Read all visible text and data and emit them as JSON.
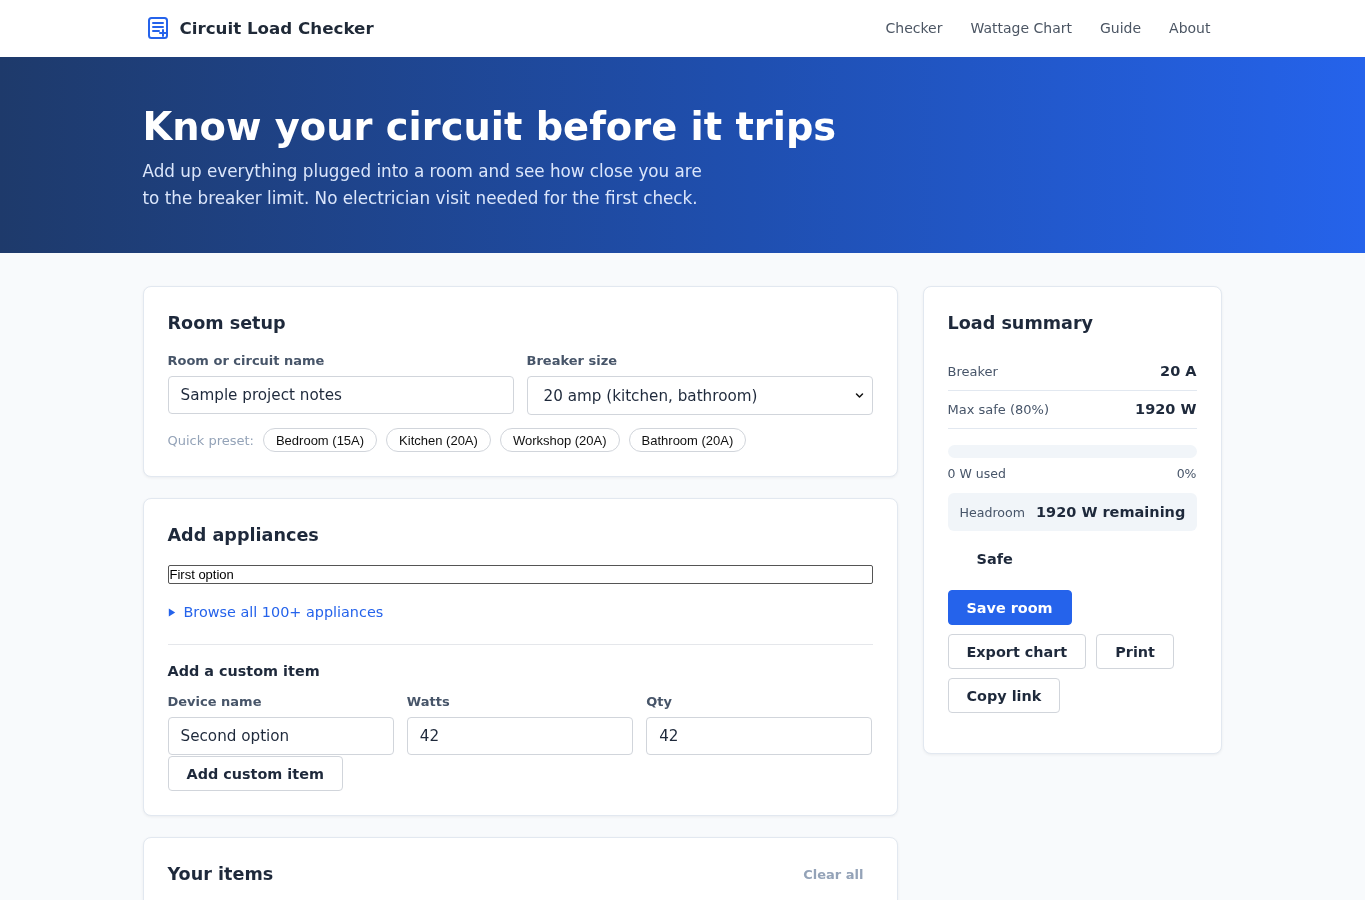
{
  "header": {
    "brand": "Circuit Load Checker",
    "nav": [
      {
        "label": "Checker"
      },
      {
        "label": "Wattage Chart"
      },
      {
        "label": "Guide"
      },
      {
        "label": "About"
      }
    ]
  },
  "hero": {
    "title": "Know your circuit before it trips",
    "subtitle": "Add up everything plugged into a room and see how close you are to the breaker limit. No electrician visit needed for the first check."
  },
  "room_setup": {
    "title": "Room setup",
    "name_field": {
      "label": "Room or circuit name",
      "value": "Sample project notes"
    },
    "breaker_field": {
      "label": "Breaker size",
      "value": "20 amp (kitchen, bathroom)"
    },
    "preset_label": "Quick preset:",
    "presets": [
      "Bedroom (15A)",
      "Kitchen (20A)",
      "Workshop (20A)",
      "Bathroom (20A)"
    ]
  },
  "add_appliances": {
    "title": "Add appliances",
    "search_field": {
      "value": "First option"
    },
    "browse": {
      "label": "Browse all 100+ appliances",
      "expanded": false
    },
    "custom": {
      "title": "Add a custom item",
      "fields": [
        {
          "label": "Device name",
          "value": "Second option"
        },
        {
          "label": "Watts",
          "value": "42"
        },
        {
          "label": "Qty",
          "value": "42"
        }
      ],
      "button": "Add custom item"
    }
  },
  "your_items": {
    "title": "Your items",
    "clear_button": "Clear all"
  },
  "summary": {
    "title": "Load summary",
    "rows": [
      {
        "label": "Breaker",
        "value": "20 A"
      },
      {
        "label": "Max safe (80%)",
        "value": "1920 W"
      }
    ],
    "usage": {
      "level": 0,
      "used": "0 W used",
      "percent": "0%"
    },
    "headroom": {
      "label": "Headroom",
      "value": "1920 W remaining"
    },
    "status": "Safe",
    "buttons": [
      {
        "label": "Save room",
        "kind": "primary"
      },
      {
        "label": "Export chart",
        "kind": "secondary"
      },
      {
        "label": "Print",
        "kind": "secondary"
      },
      {
        "label": "Copy link",
        "kind": "secondary"
      }
    ]
  }
}
